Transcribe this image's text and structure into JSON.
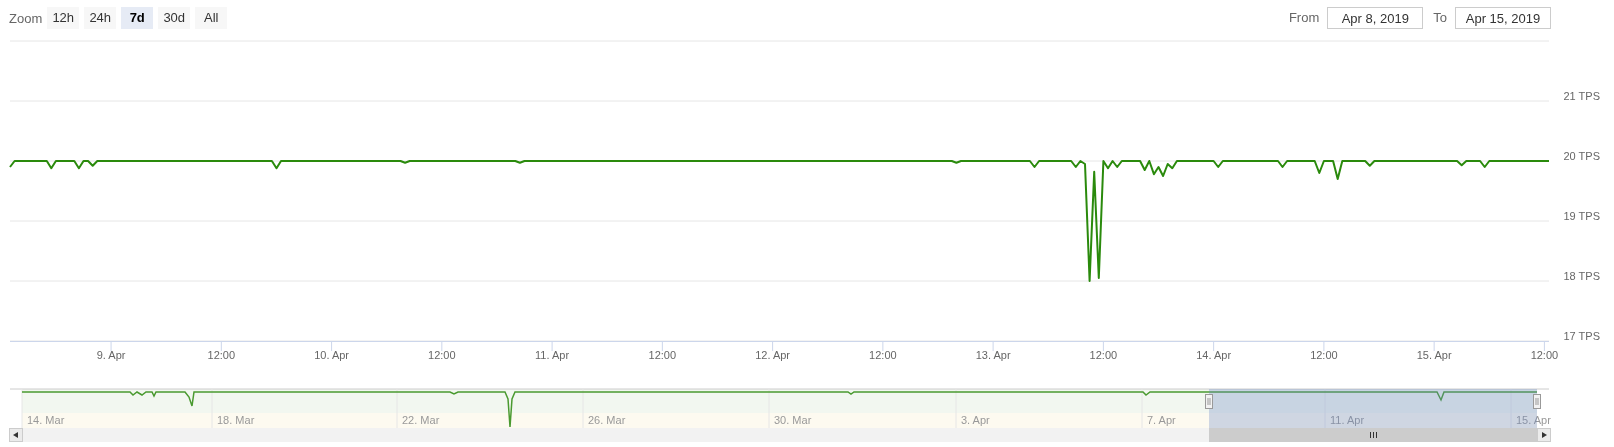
{
  "zoom": {
    "label": "Zoom",
    "buttons": [
      {
        "label": "12h",
        "selected": false
      },
      {
        "label": "24h",
        "selected": false
      },
      {
        "label": "7d",
        "selected": true
      },
      {
        "label": "30d",
        "selected": false
      },
      {
        "label": "All",
        "selected": false
      }
    ]
  },
  "range": {
    "from_label": "From",
    "from_value": "Apr 8, 2019",
    "to_label": "To",
    "to_value": "Apr 15, 2019"
  },
  "chart": {
    "chart_data": {
      "type": "line",
      "grid": true,
      "ylim": [
        17,
        22
      ],
      "categories": [
        null,
        null,
        null,
        null,
        null,
        null,
        null,
        null,
        null,
        null,
        null,
        null,
        null,
        null,
        null,
        null,
        null,
        null,
        null,
        null,
        null,
        null,
        "9. Apr",
        null,
        null,
        null,
        null,
        null,
        null,
        null,
        null,
        null,
        null,
        null,
        null,
        null,
        null,
        null,
        null,
        null,
        null,
        null,
        null,
        null,
        null,
        null,
        "12:00",
        null,
        null,
        null,
        null,
        null,
        null,
        null,
        null,
        null,
        null,
        null,
        null,
        null,
        null,
        null,
        null,
        null,
        null,
        null,
        null,
        null,
        null,
        null,
        "10. Apr",
        null,
        null,
        null,
        null,
        null,
        null,
        null,
        null,
        null,
        null,
        null,
        null,
        null,
        null,
        null,
        null,
        null,
        null,
        null,
        null,
        null,
        null,
        null,
        "12:00",
        null,
        null,
        null,
        null,
        null,
        null,
        null,
        null,
        null,
        null,
        null,
        null,
        null,
        null,
        null,
        null,
        null,
        null,
        null,
        null,
        null,
        null,
        null,
        "11. Apr",
        null,
        null,
        null,
        null,
        null,
        null,
        null,
        null,
        null,
        null,
        null,
        null,
        null,
        null,
        null,
        null,
        null,
        null,
        null,
        null,
        null,
        null,
        null,
        "12:00",
        null,
        null,
        null,
        null,
        null,
        null,
        null,
        null,
        null,
        null,
        null,
        null,
        null,
        null,
        null,
        null,
        null,
        null,
        null,
        null,
        null,
        null,
        null,
        "12. Apr",
        null,
        null,
        null,
        null,
        null,
        null,
        null,
        null,
        null,
        null,
        null,
        null,
        null,
        null,
        null,
        null,
        null,
        null,
        null,
        null,
        null,
        null,
        null,
        "12:00",
        null,
        null,
        null,
        null,
        null,
        null,
        null,
        null,
        null,
        null,
        null,
        null,
        null,
        null,
        null,
        null,
        null,
        null,
        null,
        null,
        null,
        null,
        null,
        "13. Apr",
        null,
        null,
        null,
        null,
        null,
        null,
        null,
        null,
        null,
        null,
        null,
        null,
        null,
        null,
        null,
        null,
        null,
        null,
        null,
        null,
        null,
        null,
        null,
        "12:00",
        null,
        null,
        null,
        null,
        null,
        null,
        null,
        null,
        null,
        null,
        null,
        null,
        null,
        null,
        null,
        null,
        null,
        null,
        null,
        null,
        null,
        null,
        null,
        "14. Apr",
        null,
        null,
        null,
        null,
        null,
        null,
        null,
        null,
        null,
        null,
        null,
        null,
        null,
        null,
        null,
        null,
        null,
        null,
        null,
        null,
        null,
        null,
        null,
        "12:00",
        null,
        null,
        null,
        null,
        null,
        null,
        null,
        null,
        null,
        null,
        null,
        null,
        null,
        null,
        null,
        null,
        null,
        null,
        null,
        null,
        null,
        null,
        null,
        "15. Apr",
        null,
        null,
        null,
        null,
        null,
        null,
        null,
        null,
        null,
        null,
        null,
        null,
        null,
        null,
        null,
        null,
        null,
        null,
        null,
        null,
        null,
        null,
        null,
        "12:00",
        null
      ],
      "series": [
        {
          "color": "#2a8a0c",
          "values": [
            19.9,
            20,
            20,
            20,
            20,
            20,
            20,
            20,
            20,
            19.88,
            20,
            20,
            20,
            20,
            20,
            19.88,
            20,
            20,
            19.92,
            20,
            20,
            20,
            20,
            20,
            20,
            20,
            20,
            20,
            20,
            20,
            20,
            20,
            20,
            20,
            20,
            20,
            20,
            20,
            20,
            20,
            20,
            20,
            20,
            20,
            20,
            20,
            20,
            20,
            20,
            20,
            20,
            20,
            20,
            20,
            20,
            20,
            20,
            20,
            19.88,
            20,
            20,
            20,
            20,
            20,
            20,
            20,
            20,
            20,
            20,
            20,
            20,
            20,
            20,
            20,
            20,
            20,
            20,
            20,
            20,
            20,
            20,
            20,
            20,
            20,
            20,
            20,
            19.97,
            20,
            20,
            20,
            20,
            20,
            20,
            20,
            20,
            20,
            20,
            20,
            20,
            20,
            20,
            20,
            20,
            20,
            20,
            20,
            20,
            20,
            20,
            20,
            20,
            19.97,
            20,
            20,
            20,
            20,
            20,
            20,
            20,
            20,
            20,
            20,
            20,
            20,
            20,
            20,
            20,
            20,
            20,
            20,
            20,
            20,
            20,
            20,
            20,
            20,
            20,
            20,
            20,
            20,
            20,
            20,
            20,
            20,
            20,
            20,
            20,
            20,
            20,
            20,
            20,
            20,
            20,
            20,
            20,
            20,
            20,
            20,
            20,
            20,
            20,
            20,
            20,
            20,
            20,
            20,
            20,
            20,
            20,
            20,
            20,
            20,
            20,
            20,
            20,
            20,
            20,
            20,
            20,
            20,
            20,
            20,
            20,
            20,
            20,
            20,
            20,
            20,
            20,
            20,
            20,
            20,
            20,
            20,
            20,
            20,
            20,
            20,
            20,
            20,
            20,
            20,
            20,
            20,
            20,
            20,
            19.97,
            20,
            20,
            20,
            20,
            20,
            20,
            20,
            20,
            20,
            20,
            20,
            20,
            20,
            20,
            20,
            20,
            19.9,
            20,
            20,
            20,
            20,
            20,
            20,
            20,
            20,
            19.9,
            20,
            19.95,
            18.0,
            19.82,
            18.05,
            20,
            19.88,
            20,
            19.9,
            20,
            20,
            20,
            20,
            20,
            19.85,
            20,
            19.78,
            19.9,
            19.75,
            19.95,
            19.88,
            20,
            20,
            20,
            20,
            20,
            20,
            20,
            20,
            20,
            19.9,
            20,
            20,
            20,
            20,
            20,
            20,
            20,
            20,
            20,
            20,
            20,
            20,
            20,
            19.9,
            20,
            20,
            20,
            20,
            20,
            20,
            20,
            19.8,
            20,
            20,
            20,
            19.7,
            20,
            20,
            20,
            20,
            20,
            20,
            19.92,
            20,
            20,
            20,
            20,
            20,
            20,
            20,
            20,
            20,
            20,
            20,
            20,
            20,
            20,
            20,
            20,
            20,
            20,
            20,
            19.93,
            20,
            20,
            20,
            20,
            19.9,
            20,
            20,
            20,
            20,
            20,
            20,
            20,
            20,
            20,
            20,
            20,
            20,
            20,
            20
          ]
        }
      ],
      "yticks": [
        {
          "value": 17,
          "label": "17 TPS"
        },
        {
          "value": 18,
          "label": "18 TPS"
        },
        {
          "value": 19,
          "label": "19 TPS"
        },
        {
          "value": 20,
          "label": "20 TPS"
        },
        {
          "value": 21,
          "label": "21 TPS"
        }
      ]
    }
  },
  "navigator": {
    "labels": [
      "14. Mar",
      "18. Mar",
      "22. Mar",
      "26. Mar",
      "30. Mar",
      "3. Apr",
      "7. Apr",
      "11. Apr",
      "15. Apr"
    ]
  }
}
